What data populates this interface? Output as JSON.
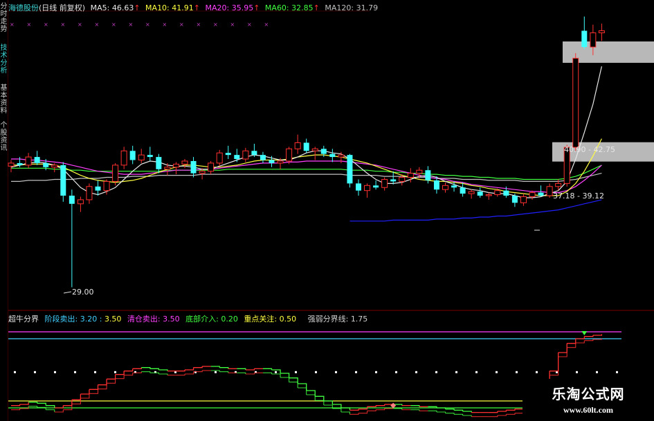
{
  "sidebar": {
    "tabs": [
      {
        "label": "分时走势",
        "active": false
      },
      {
        "label": "技术分析",
        "active": true
      },
      {
        "label": "基本资料",
        "active": false
      },
      {
        "label": "个股资讯",
        "active": false
      }
    ]
  },
  "header": {
    "stock": "海德股份",
    "mode": "(日线 前复权)",
    "ma": [
      {
        "label": "MA5:",
        "value": "46.63",
        "arrow": "↑",
        "color": "#e8e8e8"
      },
      {
        "label": "MA10:",
        "value": "41.91",
        "arrow": "↑",
        "color": "#ffff40"
      },
      {
        "label": "MA20:",
        "value": "35.95",
        "arrow": "↑",
        "color": "#ff40ff"
      },
      {
        "label": "MA60:",
        "value": "32.85",
        "arrow": "↑",
        "color": "#40ff40"
      },
      {
        "label": "MA120:",
        "value": "31.79",
        "arrow": "",
        "color": "#c0c0c0"
      }
    ]
  },
  "indicator_header": {
    "name": "超牛分界",
    "items": [
      {
        "label": "阶段卖出:",
        "value": "3.20",
        "sep": ":",
        "value2": "3.50",
        "color": "#40d0ff"
      },
      {
        "label": "清仓卖出:",
        "value": "3.50",
        "color": "#ff40ff"
      },
      {
        "label": "底部介入:",
        "value": "0.20",
        "color": "#40ff40"
      },
      {
        "label": "重点关注:",
        "value": "0.50",
        "color": "#ffff40"
      },
      {
        "label": "强弱分界线:",
        "value": "1.75",
        "color": "#d0d0d0"
      }
    ]
  },
  "annotations": {
    "low_price": "29.00",
    "range_upper": "40.90 - 42.75",
    "range_lower": "37.18 - 39.12"
  },
  "watermark": {
    "title": "乐淘公式网",
    "url": "www.60lt.com"
  },
  "colors": {
    "up": "#ff3030",
    "down": "#40ffff",
    "ma5": "#e8e8e8",
    "ma10": "#ffff40",
    "ma20": "#ff40ff",
    "ma60": "#40ff40",
    "ma120": "#c0c0c0",
    "ma250": "#2020ff",
    "indicator_up": "#ff3030",
    "indicator_down": "#40ff40"
  },
  "chart_data": {
    "type": "candlestick",
    "candles": [
      [
        40.9,
        41.5,
        40.3,
        41.2
      ],
      [
        41.2,
        41.8,
        40.8,
        41.0
      ],
      [
        41.0,
        42.2,
        40.7,
        41.8
      ],
      [
        41.8,
        42.4,
        41.0,
        41.2
      ],
      [
        41.2,
        41.6,
        40.5,
        40.8
      ],
      [
        40.8,
        41.2,
        40.3,
        41.0
      ],
      [
        41.0,
        41.3,
        37.4,
        38.0
      ],
      [
        38.0,
        38.6,
        29.0,
        37.2
      ],
      [
        37.2,
        37.9,
        36.4,
        37.6
      ],
      [
        37.6,
        39.2,
        37.2,
        38.9
      ],
      [
        38.9,
        39.5,
        38.0,
        38.5
      ],
      [
        38.5,
        39.6,
        38.1,
        39.4
      ],
      [
        39.4,
        41.2,
        39.0,
        41.0
      ],
      [
        41.0,
        42.8,
        40.6,
        42.4
      ],
      [
        42.4,
        42.9,
        41.1,
        41.5
      ],
      [
        41.5,
        42.6,
        41.2,
        42.0
      ],
      [
        42.0,
        42.8,
        41.4,
        41.8
      ],
      [
        41.8,
        42.1,
        40.2,
        40.6
      ],
      [
        40.6,
        41.2,
        40.0,
        40.8
      ],
      [
        40.8,
        41.3,
        40.1,
        41.1
      ],
      [
        41.1,
        41.6,
        40.7,
        41.4
      ],
      [
        41.4,
        41.8,
        39.8,
        40.2
      ],
      [
        40.2,
        40.7,
        39.6,
        40.4
      ],
      [
        40.4,
        41.4,
        40.1,
        41.2
      ],
      [
        41.2,
        42.5,
        40.9,
        42.2
      ],
      [
        42.2,
        42.9,
        41.6,
        42.0
      ],
      [
        42.0,
        42.6,
        41.3,
        41.6
      ],
      [
        41.6,
        42.7,
        41.3,
        42.4
      ],
      [
        42.4,
        43.1,
        41.8,
        42.0
      ],
      [
        42.0,
        42.3,
        41.2,
        41.5
      ],
      [
        41.5,
        41.9,
        40.8,
        41.2
      ],
      [
        41.2,
        41.7,
        40.6,
        41.4
      ],
      [
        41.4,
        42.8,
        41.1,
        42.6
      ],
      [
        42.6,
        44.0,
        42.1,
        43.2
      ],
      [
        43.2,
        43.6,
        42.2,
        42.4
      ],
      [
        42.4,
        42.8,
        41.5,
        42.6
      ],
      [
        42.6,
        42.9,
        41.8,
        42.1
      ],
      [
        42.1,
        42.6,
        41.3,
        41.8
      ],
      [
        41.8,
        42.3,
        41.2,
        42.0
      ],
      [
        42.0,
        42.1,
        38.8,
        39.2
      ],
      [
        39.2,
        39.6,
        38.0,
        38.5
      ],
      [
        38.5,
        39.2,
        37.8,
        39.0
      ],
      [
        39.0,
        39.5,
        38.6,
        38.8
      ],
      [
        38.8,
        39.8,
        38.5,
        39.6
      ],
      [
        39.6,
        40.4,
        39.1,
        39.4
      ],
      [
        39.4,
        40.1,
        39.0,
        39.8
      ],
      [
        39.8,
        40.7,
        39.3,
        40.2
      ],
      [
        40.2,
        40.8,
        39.7,
        40.5
      ],
      [
        40.5,
        40.9,
        39.2,
        39.5
      ],
      [
        39.5,
        39.9,
        38.2,
        38.6
      ],
      [
        38.6,
        39.3,
        38.3,
        39.0
      ],
      [
        39.0,
        39.4,
        38.4,
        38.8
      ],
      [
        38.8,
        39.3,
        37.9,
        38.2
      ],
      [
        38.2,
        38.6,
        37.7,
        38.4
      ],
      [
        38.4,
        38.8,
        37.8,
        38.0
      ],
      [
        38.0,
        38.3,
        37.6,
        38.1
      ],
      [
        38.1,
        38.7,
        37.9,
        38.5
      ],
      [
        38.5,
        38.9,
        37.8,
        38.0
      ],
      [
        38.0,
        38.2,
        36.9,
        37.3
      ],
      [
        37.3,
        38.2,
        37.0,
        37.9
      ],
      [
        37.9,
        38.5,
        37.6,
        38.3
      ],
      [
        38.3,
        39.0,
        37.9,
        38.0
      ],
      [
        38.0,
        39.2,
        37.8,
        38.9
      ],
      [
        38.9,
        39.6,
        38.5,
        39.2
      ],
      [
        39.2,
        43.0,
        38.9,
        42.75
      ],
      [
        42.75,
        52.0,
        42.4,
        51.5
      ],
      [
        54.2,
        55.6,
        52.4,
        52.6
      ],
      [
        52.6,
        54.8,
        51.8,
        54.0
      ],
      [
        54.0,
        54.9,
        53.2,
        54.2
      ]
    ],
    "ma5": [
      40.8,
      41.0,
      41.2,
      41.3,
      41.2,
      41.0,
      40.6,
      39.7,
      38.8,
      38.3,
      38.1,
      38.4,
      38.8,
      39.6,
      40.4,
      41.1,
      41.4,
      41.3,
      41.0,
      40.9,
      40.9,
      40.8,
      40.6,
      40.6,
      40.9,
      41.2,
      41.5,
      41.8,
      42.0,
      41.9,
      41.7,
      41.5,
      41.5,
      41.8,
      42.2,
      42.4,
      42.4,
      42.2,
      42.1,
      41.6,
      40.9,
      40.2,
      39.6,
      39.2,
      39.2,
      39.3,
      39.6,
      39.9,
      40.0,
      39.8,
      39.4,
      39.1,
      38.8,
      38.6,
      38.5,
      38.3,
      38.2,
      38.2,
      38.0,
      37.8,
      37.8,
      37.9,
      38.2,
      38.5,
      39.4,
      41.6,
      44.2,
      47.0,
      50.7
    ],
    "ma10": [
      41.0,
      41.0,
      41.1,
      41.1,
      41.1,
      41.0,
      40.8,
      40.4,
      40.0,
      39.7,
      39.5,
      39.4,
      39.3,
      39.4,
      39.5,
      39.7,
      40.0,
      40.3,
      40.6,
      40.8,
      41.0,
      41.0,
      40.9,
      40.8,
      40.8,
      40.9,
      41.0,
      41.2,
      41.4,
      41.5,
      41.5,
      41.5,
      41.6,
      41.8,
      41.9,
      42.0,
      42.0,
      41.9,
      41.8,
      41.6,
      41.4,
      41.2,
      40.9,
      40.6,
      40.3,
      40.0,
      39.8,
      39.6,
      39.5,
      39.4,
      39.4,
      39.3,
      39.2,
      39.0,
      38.9,
      38.7,
      38.6,
      38.4,
      38.3,
      38.2,
      38.1,
      38.0,
      38.0,
      38.0,
      38.4,
      39.2,
      40.4,
      41.9,
      43.6
    ],
    "ma20": [
      41.6,
      41.6,
      41.5,
      41.5,
      41.4,
      41.3,
      41.2,
      41.0,
      40.8,
      40.6,
      40.4,
      40.3,
      40.2,
      40.1,
      40.1,
      40.1,
      40.2,
      40.3,
      40.4,
      40.5,
      40.5,
      40.5,
      40.6,
      40.6,
      40.7,
      40.8,
      40.9,
      41.0,
      41.1,
      41.2,
      41.2,
      41.2,
      41.3,
      41.3,
      41.4,
      41.4,
      41.4,
      41.4,
      41.4,
      41.3,
      41.2,
      41.1,
      41.0,
      40.8,
      40.6,
      40.4,
      40.2,
      40.0,
      39.8,
      39.7,
      39.6,
      39.4,
      39.3,
      39.1,
      39.0,
      38.9,
      38.8,
      38.7,
      38.6,
      38.5,
      38.4,
      38.4,
      38.3,
      38.3,
      38.5,
      38.9,
      39.5,
      40.2,
      41.0
    ],
    "ma60": [
      40.7,
      40.7,
      40.7,
      40.7,
      40.7,
      40.6,
      40.6,
      40.5,
      40.5,
      40.4,
      40.4,
      40.4,
      40.4,
      40.4,
      40.4,
      40.4,
      40.4,
      40.4,
      40.5,
      40.5,
      40.5,
      40.5,
      40.5,
      40.5,
      40.5,
      40.6,
      40.6,
      40.6,
      40.6,
      40.6,
      40.6,
      40.6,
      40.6,
      40.6,
      40.6,
      40.6,
      40.6,
      40.6,
      40.6,
      40.5,
      40.5,
      40.5,
      40.4,
      40.4,
      40.3,
      40.3,
      40.2,
      40.2,
      40.1,
      40.1,
      40.0,
      40.0,
      39.9,
      39.9,
      39.8,
      39.8,
      39.7,
      39.7,
      39.7,
      39.6,
      39.6,
      39.6,
      39.6,
      39.6,
      39.7,
      39.9,
      40.2,
      40.6,
      41.0
    ],
    "ma120": [
      39.4,
      39.4,
      39.5,
      39.5,
      39.5,
      39.6,
      39.6,
      39.6,
      39.7,
      39.7,
      39.7,
      39.8,
      39.8,
      39.8,
      39.9,
      39.9,
      39.9,
      40.0,
      40.0,
      40.0,
      40.0,
      40.0,
      40.1,
      40.1,
      40.1,
      40.1,
      40.1,
      40.1,
      40.1,
      40.1,
      40.1,
      40.1,
      40.1,
      40.1,
      40.1,
      40.1,
      40.1,
      40.1,
      40.1,
      40.0,
      40.0,
      40.0,
      40.0,
      39.9,
      39.9,
      39.9,
      39.8,
      39.8,
      39.8,
      39.7,
      39.7,
      39.7,
      39.6,
      39.6,
      39.6,
      39.5,
      39.5,
      39.5,
      39.5,
      39.4,
      39.4,
      39.4,
      39.4,
      39.4,
      39.5,
      39.6,
      39.8,
      40.0,
      40.2
    ],
    "ma250": [
      null,
      null,
      null,
      null,
      null,
      null,
      null,
      null,
      null,
      null,
      null,
      null,
      null,
      null,
      null,
      null,
      null,
      null,
      null,
      null,
      null,
      null,
      null,
      null,
      null,
      null,
      null,
      null,
      null,
      null,
      null,
      null,
      null,
      null,
      null,
      null,
      null,
      null,
      null,
      35.5,
      35.5,
      35.5,
      35.5,
      35.5,
      35.6,
      35.6,
      35.6,
      35.6,
      35.6,
      35.7,
      35.7,
      35.7,
      35.8,
      35.8,
      35.9,
      35.9,
      36.0,
      36.0,
      36.1,
      36.2,
      36.3,
      36.4,
      36.5,
      36.6,
      36.8,
      37.0,
      37.2,
      37.4,
      37.6
    ],
    "price_ylim": [
      27.0,
      56.0
    ],
    "indicator": {
      "levels": [
        3.5,
        3.2,
        1.75,
        0.5,
        0.2
      ],
      "values": [
        0.3,
        0.35,
        0.45,
        0.4,
        0.3,
        0.2,
        0.3,
        0.55,
        0.8,
        1.0,
        1.2,
        1.45,
        1.65,
        1.8,
        1.9,
        1.95,
        1.9,
        1.85,
        1.8,
        1.8,
        1.85,
        1.95,
        2.0,
        2.0,
        1.95,
        1.9,
        1.9,
        1.85,
        1.9,
        1.9,
        1.85,
        1.7,
        1.5,
        1.25,
        0.95,
        0.7,
        0.5,
        0.35,
        0.2,
        0.1,
        0.15,
        0.25,
        0.3,
        0.35,
        0.35,
        0.3,
        0.3,
        0.25,
        0.25,
        0.2,
        0.15,
        0.1,
        0.05,
        0.0,
        0.0,
        0.0,
        0.05,
        0.1,
        0.15,
        0.25,
        0.4,
        0.8,
        1.8,
        2.6,
        3.0,
        3.2,
        3.3,
        3.35,
        3.4
      ],
      "ylim": [
        -0.1,
        3.8
      ]
    }
  }
}
